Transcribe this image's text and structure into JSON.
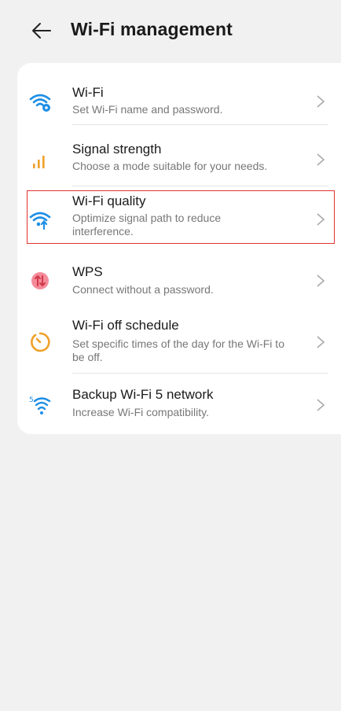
{
  "header": {
    "title": "Wi-Fi management"
  },
  "items": [
    {
      "title": "Wi-Fi",
      "subtitle": "Set Wi-Fi name and password."
    },
    {
      "title": "Signal strength",
      "subtitle": "Choose a mode suitable for your needs."
    },
    {
      "title": "Wi-Fi quality",
      "subtitle": "Optimize signal path to reduce interference."
    },
    {
      "title": "WPS",
      "subtitle": "Connect without a password."
    },
    {
      "title": "Wi-Fi off schedule",
      "subtitle": "Set specific times of the day for the Wi-Fi to be off."
    },
    {
      "title": "Backup Wi-Fi 5 network",
      "subtitle": "Increase Wi-Fi compatibility.",
      "badge": "5"
    }
  ],
  "colors": {
    "blue": "#1e8fe6",
    "orange": "#f0a12a",
    "pink": "#f48b9b",
    "red_accent": "#d0394a",
    "highlight_border": "#e0332f"
  },
  "icons": [
    "wifi-settings-icon",
    "signal-bars-icon",
    "wifi-quality-icon",
    "wps-icon",
    "timer-icon",
    "wifi5-icon",
    "back-arrow-icon",
    "chevron-right-icon"
  ]
}
